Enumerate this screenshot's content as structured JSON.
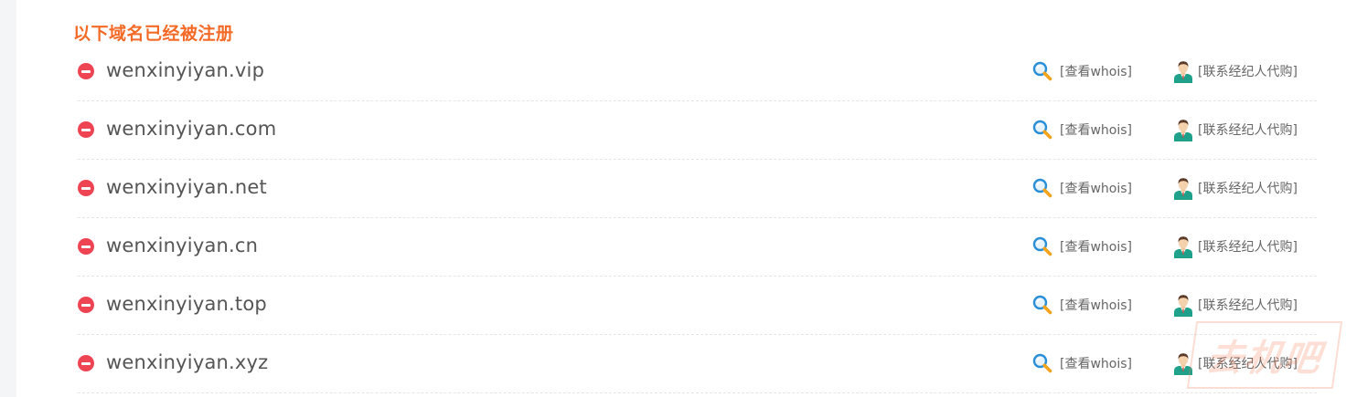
{
  "section": {
    "title": "以下域名已经被注册"
  },
  "registered_domains": [
    {
      "domain": "wenxinyiyan.vip",
      "whois_label": "[查看whois]",
      "broker_label": "[联系经纪人代购]"
    },
    {
      "domain": "wenxinyiyan.com",
      "whois_label": "[查看whois]",
      "broker_label": "[联系经纪人代购]"
    },
    {
      "domain": "wenxinyiyan.net",
      "whois_label": "[查看whois]",
      "broker_label": "[联系经纪人代购]"
    },
    {
      "domain": "wenxinyiyan.cn",
      "whois_label": "[查看whois]",
      "broker_label": "[联系经纪人代购]"
    },
    {
      "domain": "wenxinyiyan.top",
      "whois_label": "[查看whois]",
      "broker_label": "[联系经纪人代购]"
    },
    {
      "domain": "wenxinyiyan.xyz",
      "whois_label": "[查看whois]",
      "broker_label": "[联系经纪人代购]"
    }
  ],
  "icons": {
    "status": "no-entry-icon",
    "whois": "magnifier-icon",
    "broker": "agent-avatar-icon"
  },
  "colors": {
    "title": "#f46a26",
    "status_red": "#ee4454",
    "domain_text": "#555555",
    "link_text": "#666666"
  },
  "watermark": {
    "text": "去机吧"
  }
}
